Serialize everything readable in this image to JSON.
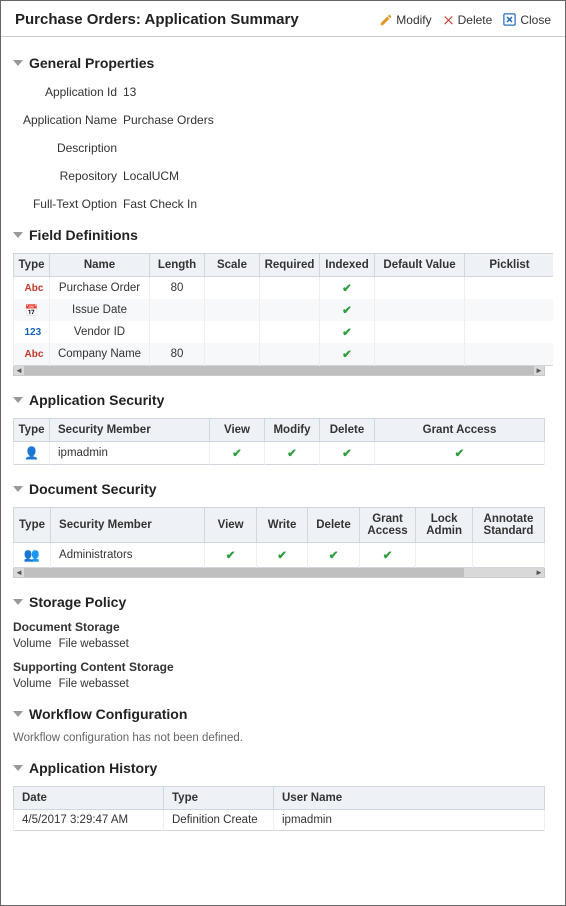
{
  "header": {
    "title": "Purchase Orders: Application Summary",
    "modify": "Modify",
    "delete": "Delete",
    "close": "Close"
  },
  "general": {
    "heading": "General Properties",
    "labels": {
      "appId": "Application Id",
      "appName": "Application Name",
      "description": "Description",
      "repository": "Repository",
      "fulltext": "Full-Text Option"
    },
    "values": {
      "appId": "13",
      "appName": "Purchase Orders",
      "description": "",
      "repository": "LocalUCM",
      "fulltext": "Fast Check In"
    }
  },
  "fieldDefs": {
    "heading": "Field Definitions",
    "cols": [
      "Type",
      "Name",
      "Length",
      "Scale",
      "Required",
      "Indexed",
      "Default Value",
      "Picklist"
    ],
    "rows": [
      {
        "typeIcon": "abc",
        "name": "Purchase Order",
        "length": "80",
        "indexed": true
      },
      {
        "typeIcon": "date",
        "name": "Issue Date",
        "length": "",
        "indexed": true
      },
      {
        "typeIcon": "num",
        "name": "Vendor ID",
        "length": "",
        "indexed": true
      },
      {
        "typeIcon": "abc",
        "name": "Company Name",
        "length": "80",
        "indexed": true
      }
    ]
  },
  "appSec": {
    "heading": "Application Security",
    "cols": [
      "Type",
      "Security Member",
      "View",
      "Modify",
      "Delete",
      "Grant Access"
    ],
    "rows": [
      {
        "icon": "user",
        "member": "ipmadmin",
        "view": true,
        "modify": true,
        "delete": true,
        "grant": true
      }
    ]
  },
  "docSec": {
    "heading": "Document Security",
    "cols": [
      "Type",
      "Security Member",
      "View",
      "Write",
      "Delete",
      "Grant Access",
      "Lock Admin",
      "Annotate Standard"
    ],
    "rows": [
      {
        "icon": "group",
        "member": "Administrators",
        "view": true,
        "write": true,
        "delete": true,
        "grant": true,
        "lock": false,
        "annotate": false
      }
    ]
  },
  "storage": {
    "heading": "Storage Policy",
    "docStorageHead": "Document Storage",
    "volumeLabel": "Volume",
    "docVolume": "File webasset",
    "supportingHead": "Supporting Content Storage",
    "supportingVolume": "File webasset"
  },
  "workflow": {
    "heading": "Workflow Configuration",
    "note": "Workflow configuration has not been defined."
  },
  "history": {
    "heading": "Application History",
    "cols": [
      "Date",
      "Type",
      "User Name"
    ],
    "rows": [
      {
        "date": "4/5/2017 3:29:47 AM",
        "type": "Definition Create",
        "user": "ipmadmin"
      }
    ]
  }
}
